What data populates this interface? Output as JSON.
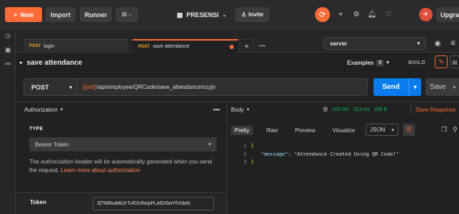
{
  "topbar": {
    "new_label": "New",
    "import_label": "Import",
    "runner_label": "Runner",
    "workspace_label": "PRESENSI",
    "invite_label": "Invite",
    "upgrade_label": "Upgrade",
    "accent": "#ff6c37"
  },
  "tabs": [
    {
      "method": "POST",
      "name": "login"
    },
    {
      "method": "POST",
      "name": "save attendance"
    }
  ],
  "environment": "server",
  "request": {
    "title": "save attendance",
    "examples_label": "Examples",
    "examples_count": "0",
    "build_label": "BUILD",
    "method": "POST",
    "url_var": "{{url}}",
    "url_path": "/api/employee/QRCode/save_attendance/vzyjn",
    "send_label": "Send",
    "save_label": "Save"
  },
  "auth": {
    "header": "Authorization",
    "type_label": "TYPE",
    "type_value": "Bearer Token",
    "note": "The authorization header will be automatically generated when you send the request.",
    "link": "Learn more about authorization",
    "token_label": "Token",
    "token_value": "3|TMRutMk2rTvfOVlhepPLAl0XlwYfVt3e9."
  },
  "response": {
    "body_label": "Body",
    "status": "200 OK",
    "time": "313 ms",
    "size": "355 B",
    "save_response_label": "Save Response",
    "tabs": [
      "Pretty",
      "Raw",
      "Preview",
      "Visualize"
    ],
    "format": "JSON",
    "lines": [
      {
        "n": "1",
        "open": "{"
      },
      {
        "n": "2",
        "key": "\"message\"",
        "value": "\"Attendance Created Using QR Code!\""
      },
      {
        "n": "3",
        "close": "}"
      }
    ]
  }
}
